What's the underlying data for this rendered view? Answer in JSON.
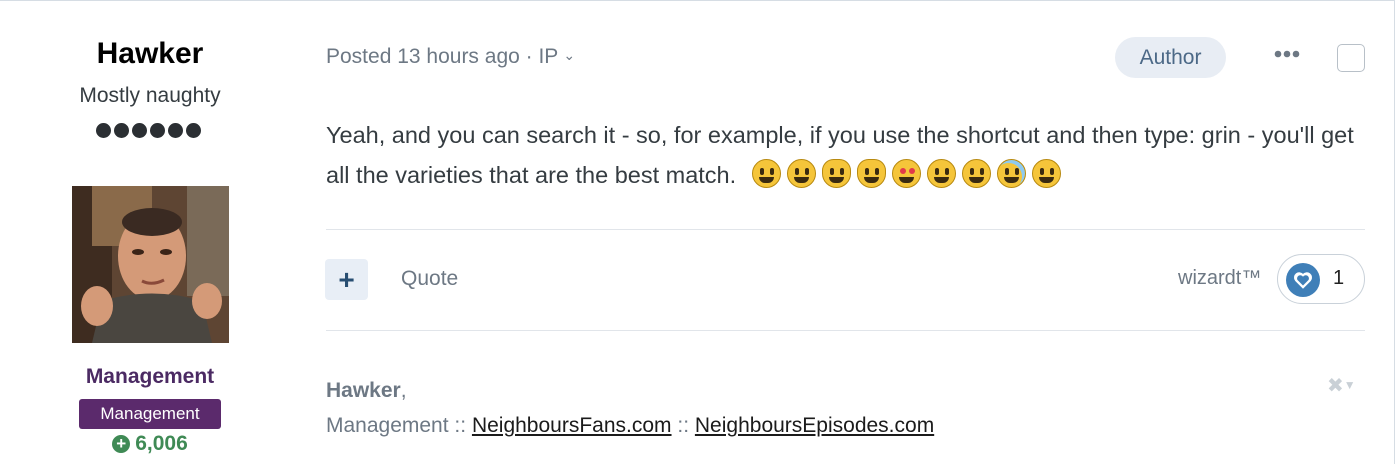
{
  "author": {
    "name": "Hawker",
    "title": "Mostly naughty",
    "rank_dots": 6,
    "group": "Management",
    "group_badge": "Management",
    "reputation": "6,006",
    "reputation_icon": "plus-circle-icon"
  },
  "post": {
    "meta_posted": "Posted 13 hours ago · IP",
    "meta_chevron": "chevron-down-icon",
    "author_badge": "Author",
    "more_icon": "ellipsis-icon",
    "content_text": "Yeah, and you can search it - so, for example, if you use the shortcut and then type: grin - you'll get all the varieties that are the best match.",
    "emoji": [
      "grinning",
      "grin",
      "smile-cat",
      "smiley-cat",
      "star-struck",
      "smiley",
      "smile",
      "sweat-smile",
      "laughing"
    ]
  },
  "actions": {
    "plus_label": "+",
    "quote_label": "Quote",
    "liked_by": "wizardt™",
    "reaction_icon": "heart-icon",
    "reaction_count": "1"
  },
  "signature": {
    "name": "Hawker",
    "name_suffix": ",",
    "prefix": "Management ::",
    "link1": "NeighboursFans.com",
    "separator": "::",
    "link2": "NeighboursEpisodes.com",
    "close_icon": "close-icon"
  },
  "colors": {
    "group": "#4b2a63",
    "badge_bg": "#5b2a6c",
    "reputation": "#3f8a55",
    "author_badge_bg": "#e8edf4",
    "reaction": "#3f7fb8"
  }
}
